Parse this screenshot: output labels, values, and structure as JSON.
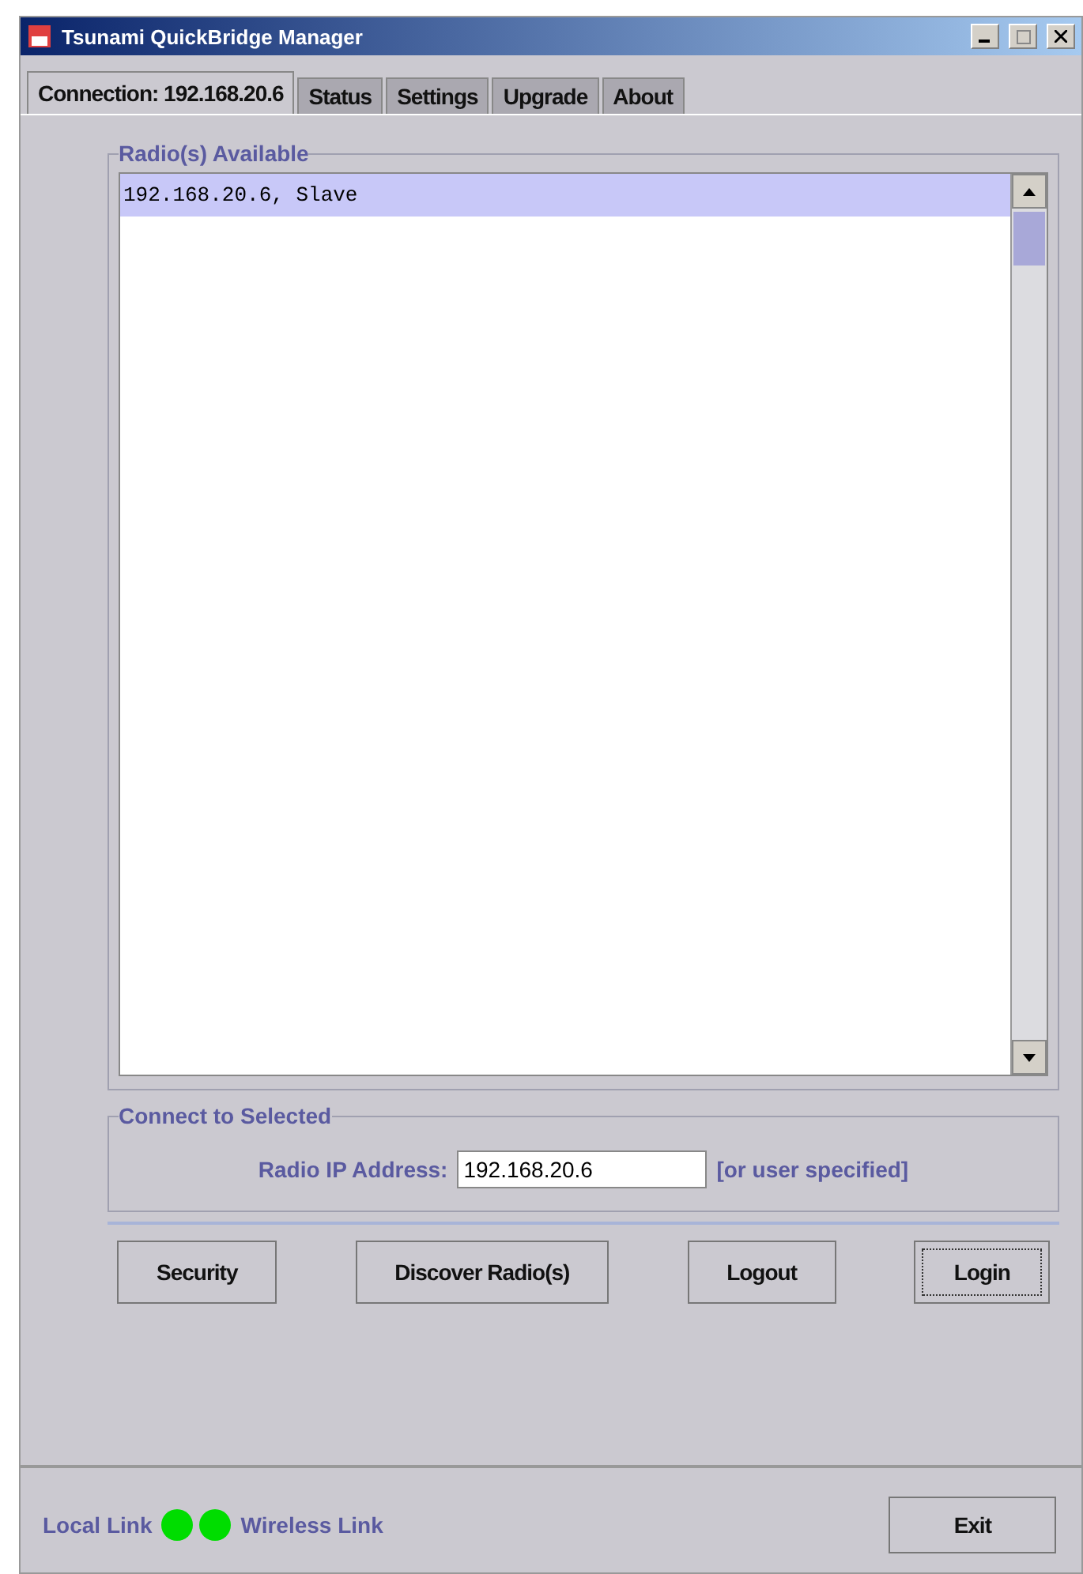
{
  "window": {
    "title": "Tsunami QuickBridge Manager"
  },
  "tabs": [
    {
      "label": "Connection: 192.168.20.6",
      "selected": true
    },
    {
      "label": "Status",
      "selected": false
    },
    {
      "label": "Settings",
      "selected": false
    },
    {
      "label": "Upgrade",
      "selected": false
    },
    {
      "label": "About",
      "selected": false
    }
  ],
  "radios_group": {
    "title": "Radio(s) Available",
    "items": [
      {
        "label": "192.168.20.6, Slave",
        "selected": true
      }
    ]
  },
  "connect_group": {
    "title": "Connect to Selected",
    "field_label": "Radio IP Address:",
    "value": "192.168.20.6",
    "hint": "[or user specified]"
  },
  "buttons": [
    {
      "label": "Security",
      "focused": false
    },
    {
      "label": "Discover Radio(s)",
      "focused": false
    },
    {
      "label": "Logout",
      "focused": false
    },
    {
      "label": "Login",
      "focused": true
    }
  ],
  "status": {
    "links": [
      {
        "label": "Local Link",
        "color": "#00dd00"
      },
      {
        "label": "Wireless Link",
        "color": "#00dd00"
      }
    ],
    "exit": "Exit"
  }
}
